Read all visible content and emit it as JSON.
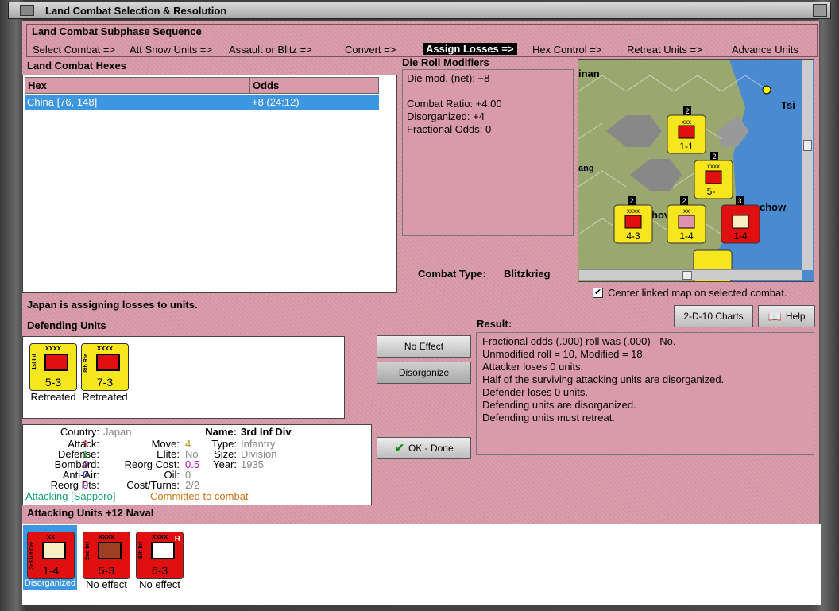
{
  "window": {
    "title": "Land Combat Selection & Resolution"
  },
  "subphase": {
    "label": "Land Combat Subphase Sequence",
    "steps": [
      "Select Combat =>",
      "Att Snow Units =>",
      "Assault or Blitz =>",
      "Convert =>",
      "Assign Losses =>",
      "Hex Control =>",
      "Retreat Units =>",
      "Advance Units"
    ],
    "active_index": 4
  },
  "hexes": {
    "label": "Land Combat Hexes",
    "columns": [
      "Hex",
      "Odds"
    ],
    "rows": [
      {
        "hex": "China [76, 148]",
        "odds": "+8 (24:12)"
      }
    ]
  },
  "drm": {
    "label": "Die Roll Modifiers",
    "lines": [
      "Die mod. (net): +8",
      "",
      "Combat Ratio: +4.00",
      "Disorganized: +4",
      "Fractional Odds: 0"
    ]
  },
  "combat_type": {
    "label": "Combat Type:",
    "value": "Blitzkrieg"
  },
  "map": {
    "labels": [
      "inan",
      "Tsi",
      "ang",
      "chow",
      "hov"
    ],
    "counters": [
      {
        "size": "xxx",
        "str": "1-1",
        "badge": "2"
      },
      {
        "size": "xxxx",
        "str": "5-",
        "badge": "2"
      },
      {
        "size": "xxxx",
        "str": "4-3",
        "badge": "2"
      },
      {
        "size": "xx",
        "str": "1-4",
        "badge": "2"
      },
      {
        "size": "",
        "str": "1-4",
        "badge": "3"
      }
    ]
  },
  "center_linked": {
    "label": "Center linked map on selected combat.",
    "checked": true
  },
  "status_msg": "Japan is assigning losses to units.",
  "buttons": {
    "charts": "2-D-10 Charts",
    "help": "Help",
    "no_effect": "No Effect",
    "disorganize": "Disorganize",
    "ok": "OK - Done"
  },
  "defending": {
    "label": "Defending Units",
    "units": [
      {
        "name": "1st Inf",
        "size": "xxxx",
        "str": "5-3",
        "status": "Retreated",
        "color": "#f5e61e"
      },
      {
        "name": "8th Rte",
        "size": "xxxx",
        "str": "7-3",
        "status": "Retreated",
        "color": "#f5e61e"
      }
    ]
  },
  "result": {
    "label": "Result:",
    "lines": [
      "Fractional odds (.000) roll was (.000)  - No.",
      "Unmodified roll = 10, Modified = 18.",
      "Attacker loses 0 units.",
      "Half of the surviving attacking units are disorganized.",
      "Defender loses 0 units.",
      "Defending units are disorganized.",
      "Defending units must retreat."
    ]
  },
  "unit_info": {
    "country_label": "Country:",
    "country": "Japan",
    "attack_label": "Attack:",
    "attack": "1",
    "defense_label": "Defense:",
    "defense": "1",
    "bombard_label": "Bombard:",
    "bombard": "0",
    "antiair_label": "Anti-Air:",
    "antiair": "0",
    "reorgpts_label": "Reorg Pts:",
    "reorgpts": "0",
    "move_label": "Move:",
    "move": "4",
    "elite_label": "Elite:",
    "elite": "No",
    "reorgcost_label": "Reorg Cost:",
    "reorgcost": "0.5",
    "oil_label": "Oil:",
    "oil": "0",
    "costturns_label": "Cost/Turns:",
    "costturns": "2/2",
    "name_label": "Name:",
    "name": "3rd Inf Div",
    "type_label": "Type:",
    "type": "Infantry",
    "size_label": "Size:",
    "size": "Division",
    "year_label": "Year:",
    "year": "1935",
    "attacking": "Attacking [Sapporo]",
    "committed": "Committed to combat"
  },
  "attacking": {
    "label": "Attacking Units +12 Naval",
    "units": [
      {
        "name": "3rd Inf Div",
        "size": "xx",
        "str": "1-4",
        "status": "Disorganized",
        "selected": true
      },
      {
        "name": "2nd Inf",
        "size": "xxxx",
        "str": "5-3",
        "status": "No effect",
        "selected": false
      },
      {
        "name": "6th Inf",
        "size": "xxxx",
        "str": "6-3",
        "status": "No effect",
        "selected": false,
        "reserve": "R"
      }
    ]
  }
}
